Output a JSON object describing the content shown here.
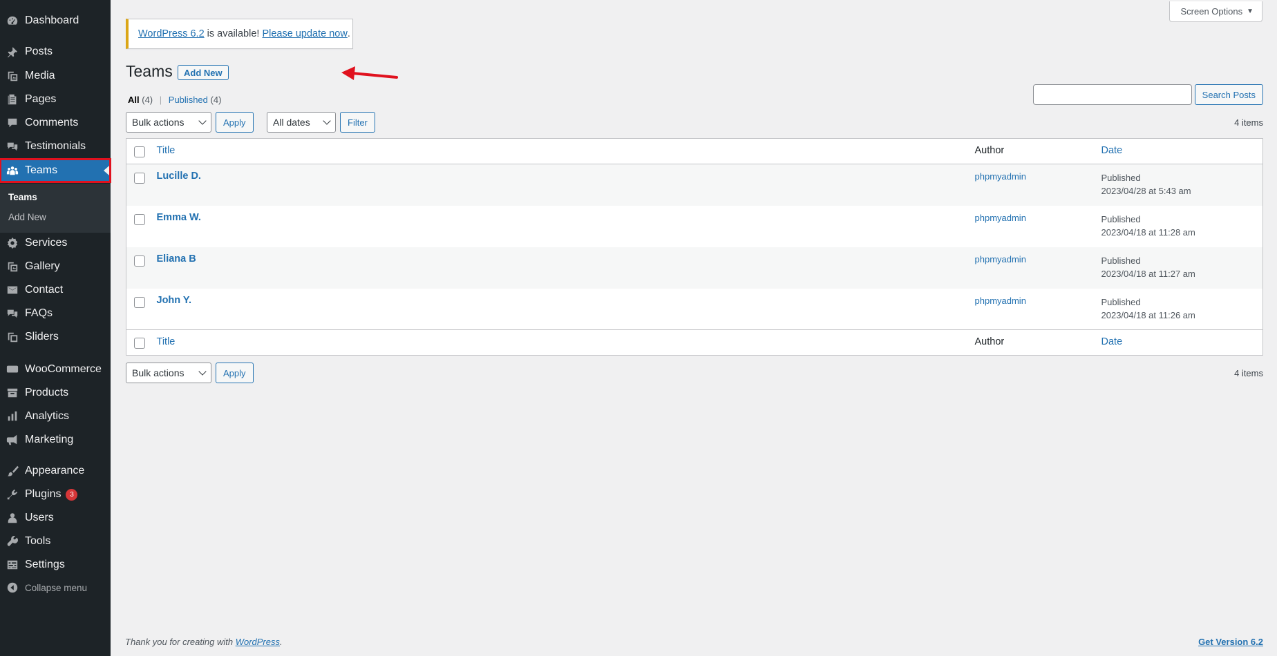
{
  "sidebar": {
    "items": [
      {
        "label": "Dashboard",
        "icon": "dashboard-icon"
      },
      {
        "label": "Posts",
        "icon": "pin-icon"
      },
      {
        "label": "Media",
        "icon": "media-icon"
      },
      {
        "label": "Pages",
        "icon": "pages-icon"
      },
      {
        "label": "Comments",
        "icon": "comment-icon"
      },
      {
        "label": "Testimonials",
        "icon": "testimonial-icon"
      },
      {
        "label": "Teams",
        "icon": "groups-icon"
      },
      {
        "label": "Services",
        "icon": "gear-icon"
      },
      {
        "label": "Gallery",
        "icon": "gallery-icon"
      },
      {
        "label": "Contact",
        "icon": "email-icon"
      },
      {
        "label": "FAQs",
        "icon": "faq-icon"
      },
      {
        "label": "Sliders",
        "icon": "slides-icon"
      },
      {
        "label": "WooCommerce",
        "icon": "woo-icon"
      },
      {
        "label": "Products",
        "icon": "archive-icon"
      },
      {
        "label": "Analytics",
        "icon": "chart-bar-icon"
      },
      {
        "label": "Marketing",
        "icon": "megaphone-icon"
      },
      {
        "label": "Appearance",
        "icon": "brush-icon"
      },
      {
        "label": "Plugins",
        "icon": "plugin-icon",
        "badge": "3"
      },
      {
        "label": "Users",
        "icon": "user-icon"
      },
      {
        "label": "Tools",
        "icon": "wrench-icon"
      },
      {
        "label": "Settings",
        "icon": "settings-icon"
      },
      {
        "label": "Collapse menu",
        "icon": "collapse-icon"
      }
    ],
    "submenu": [
      {
        "label": "Teams"
      },
      {
        "label": "Add New"
      }
    ]
  },
  "header": {
    "screen_options": "Screen Options"
  },
  "notice": {
    "version_link": "WordPress 6.2",
    "middle_text": " is available! ",
    "update_link": "Please update now",
    "end_text": "."
  },
  "page": {
    "title": "Teams",
    "add_new": "Add New"
  },
  "filters": {
    "all_label": "All",
    "all_count": "(4)",
    "published_label": "Published",
    "published_count": "(4)",
    "separator": "|"
  },
  "search": {
    "button": "Search Posts",
    "value": ""
  },
  "tablenav": {
    "bulk_actions": "Bulk actions",
    "apply": "Apply",
    "all_dates": "All dates",
    "filter": "Filter",
    "items_count": "4 items"
  },
  "table": {
    "columns": {
      "title": "Title",
      "author": "Author",
      "date": "Date"
    },
    "rows": [
      {
        "title": "Lucille D.",
        "author": "phpmyadmin",
        "status": "Published",
        "date": "2023/04/28 at 5:43 am"
      },
      {
        "title": "Emma W.",
        "author": "phpmyadmin",
        "status": "Published",
        "date": "2023/04/18 at 11:28 am"
      },
      {
        "title": "Eliana B",
        "author": "phpmyadmin",
        "status": "Published",
        "date": "2023/04/18 at 11:27 am"
      },
      {
        "title": "John Y.",
        "author": "phpmyadmin",
        "status": "Published",
        "date": "2023/04/18 at 11:26 am"
      }
    ]
  },
  "footer": {
    "thanks_text": "Thank you for creating with ",
    "wordpress_link": "WordPress",
    "thanks_end": ".",
    "get_version": "Get Version 6.2"
  },
  "colors": {
    "sidebar_bg": "#1d2327",
    "accent": "#2271b1",
    "highlight_outline": "#e0111e",
    "notice_warning": "#dba617"
  }
}
